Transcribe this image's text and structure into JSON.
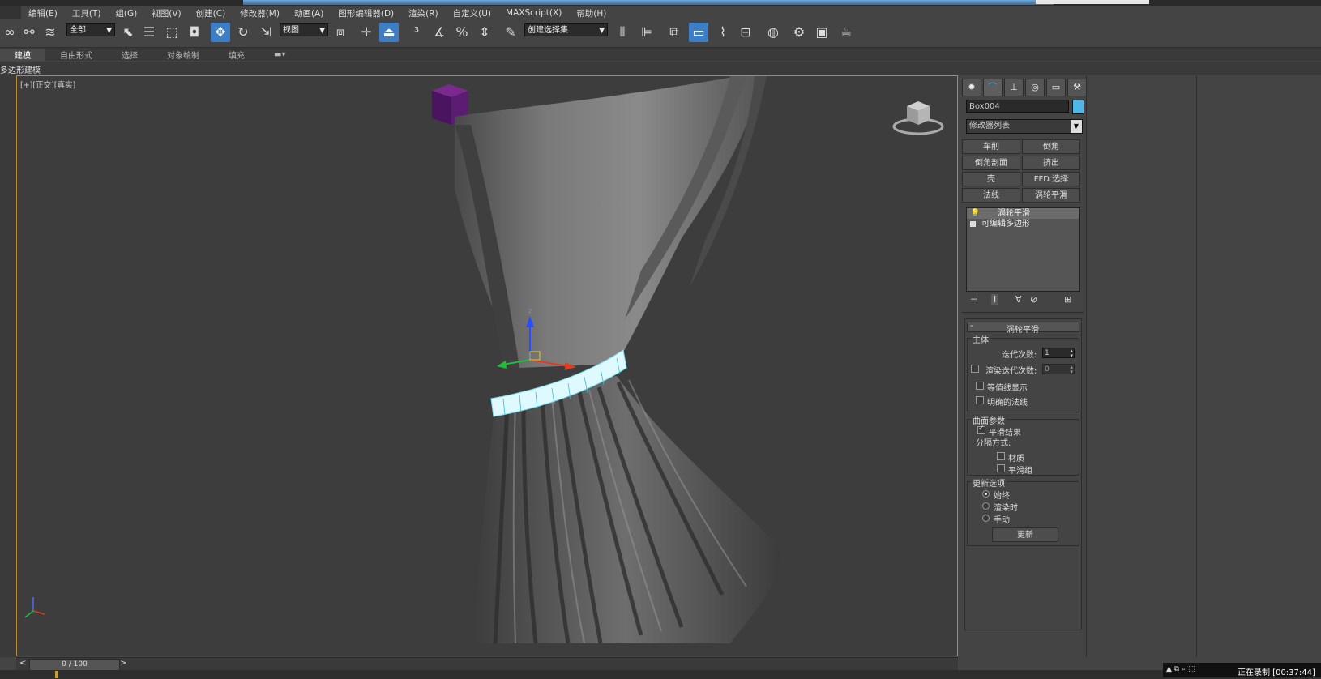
{
  "menu": [
    "编辑(E)",
    "工具(T)",
    "组(G)",
    "视图(V)",
    "创建(C)",
    "修改器(M)",
    "动画(A)",
    "图形编辑器(D)",
    "渲染(R)",
    "自定义(U)",
    "MAXScript(X)",
    "帮助(H)"
  ],
  "toolbar": {
    "filter_value": "全部",
    "coord_value": "视图",
    "selset_value": "创建选择集"
  },
  "ribbon": {
    "tabs": [
      "建模",
      "自由形式",
      "选择",
      "对象绘制",
      "填充"
    ],
    "sub_label": "多边形建模"
  },
  "viewport": {
    "label": "[+][正交][真实]"
  },
  "command_panel": {
    "tabs": [
      "create-icon",
      "modify-icon",
      "hierarchy-icon",
      "motion-icon",
      "display-icon",
      "utilities-icon"
    ],
    "object_name": "Box004",
    "object_color": "#4fb6e8",
    "modifier_list": "修改器列表",
    "modifier_buttons": [
      "车削",
      "倒角",
      "倒角剖面",
      "挤出",
      "壳",
      "FFD 选择",
      "法线",
      "涡轮平滑"
    ],
    "stack": [
      "涡轮平滑",
      "可编辑多边形"
    ],
    "rollout_title": "涡轮平滑",
    "main_group": "主体",
    "iterations_label": "迭代次数:",
    "iterations_value": "1",
    "render_iters_label": "渲染迭代次数:",
    "render_iters_value": "0",
    "isoline_label": "等值线显示",
    "explicit_normals_label": "明确的法线",
    "surface_group": "曲面参数",
    "smooth_result_label": "平滑结果",
    "separate_by_label": "分隔方式:",
    "materials_label": "材质",
    "smoothing_groups_label": "平滑组",
    "update_group": "更新选项",
    "always_label": "始终",
    "when_rendering_label": "渲染时",
    "manually_label": "手动",
    "update_button": "更新"
  },
  "timeline": {
    "frame": "0 / 100"
  },
  "recording": {
    "status": "正在录制 [00:37:44]"
  }
}
